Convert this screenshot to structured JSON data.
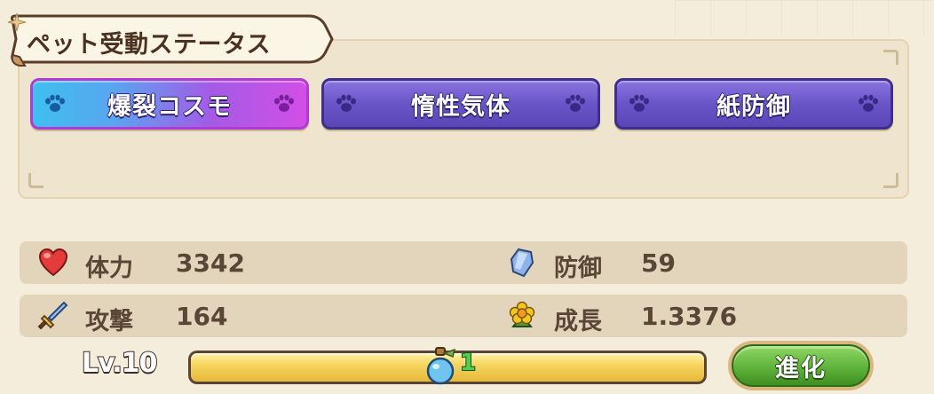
{
  "panel": {
    "title": "ペット受動ステータス"
  },
  "skills": [
    {
      "label": "爆裂コスモ",
      "selected": true
    },
    {
      "label": "惰性気体",
      "selected": false
    },
    {
      "label": "紙防御",
      "selected": false
    }
  ],
  "stats": {
    "hp": {
      "label": "体力",
      "value": "3342",
      "icon": "heart-icon"
    },
    "defense": {
      "label": "防御",
      "value": "59",
      "icon": "shield-crystal-icon"
    },
    "attack": {
      "label": "攻撃",
      "value": "164",
      "icon": "sword-icon"
    },
    "growth": {
      "label": "成長",
      "value": "1.3376",
      "icon": "flower-icon"
    }
  },
  "level": {
    "text": "Lv.10",
    "progress_fraction": 1.0
  },
  "potion": {
    "icon": "potion-icon",
    "count": "1"
  },
  "evolve_button": {
    "label": "進化"
  },
  "colors": {
    "background": "#f4eddc",
    "skill_inactive": "#6a55c8",
    "skill_active_start": "#3ec0f0",
    "skill_active_end": "#d24fe6",
    "stat_row": "#e3d5bb",
    "evolve_green": "#5fb33b",
    "progress_yellow": "#f6d561"
  }
}
